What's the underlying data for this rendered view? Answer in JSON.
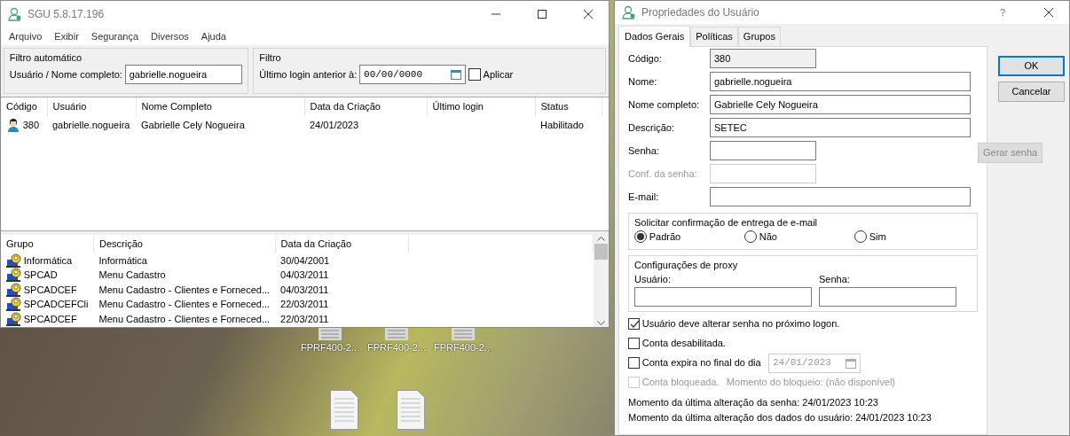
{
  "desktop": {
    "icons": [
      {
        "label": "FPRF400-2..."
      },
      {
        "label": "FPRF400-2..."
      },
      {
        "label": "FPRF400-2..."
      }
    ]
  },
  "main_window": {
    "title": "SGU 5.8.17.196",
    "menu": [
      "Arquivo",
      "Exibir",
      "Segurança",
      "Diversos",
      "Ajuda"
    ],
    "auto_filter": {
      "legend": "Filtro automático",
      "label": "Usuário / Nome completo:",
      "value": "gabrielle.nogueira"
    },
    "filter": {
      "legend": "Filtro",
      "label": "Último login anterior à:",
      "value": "00/00/0000",
      "apply_label": "Aplicar",
      "apply_checked": false
    },
    "users_table": {
      "columns": [
        "Código",
        "Usuário",
        "Nome Completo",
        "Data da Criação",
        "Último login",
        "Status"
      ],
      "rows": [
        {
          "code": "380",
          "user": "gabrielle.nogueira",
          "full_name": "Gabrielle Cely Nogueira",
          "created": "24/01/2023",
          "status": "Habilitado"
        }
      ]
    },
    "groups_table": {
      "columns": [
        "Grupo",
        "Descrição",
        "Data da Criação"
      ],
      "rows": [
        {
          "group": "Informática",
          "description": "Informática",
          "created": "30/04/2001"
        },
        {
          "group": "SPCAD",
          "description": "Menu Cadastro",
          "created": "04/03/2011"
        },
        {
          "group": "SPCADCEF",
          "description": "Menu Cadastro - Clientes e Forneced...",
          "created": "04/03/2011"
        },
        {
          "group": "SPCADCEFCli",
          "description": "Menu Cadastro - Clientes e Forneced...",
          "created": "22/03/2011"
        },
        {
          "group": "SPCADCEF",
          "description": "Menu Cadastro - Clientes e Forneced...",
          "created": "22/03/2011"
        }
      ]
    }
  },
  "dialog": {
    "title": "Propriedades do Usuário",
    "help": "?",
    "tabs": [
      {
        "label": "Dados Gerais",
        "selected": true
      },
      {
        "label": "Políticas",
        "selected": false
      },
      {
        "label": "Grupos",
        "selected": false
      }
    ],
    "fields": [
      {
        "kind": "readonly",
        "label": "Código:",
        "value": "380",
        "disabled": false
      },
      {
        "kind": "wide",
        "label": "Nome:",
        "value": "gabrielle.nogueira",
        "disabled": false
      },
      {
        "kind": "wide",
        "label": "Nome completo:",
        "value": "Gabrielle Cely Nogueira",
        "disabled": false
      },
      {
        "kind": "wide",
        "label": "Descrição:",
        "value": "SETEC",
        "disabled": false
      },
      {
        "kind": "short",
        "label": "Senha:",
        "disabled": false
      },
      {
        "kind": "short",
        "label": "Conf. da senha:",
        "disabled": true
      },
      {
        "kind": "wide",
        "label": "E-mail:",
        "disabled": false
      }
    ],
    "generate_button": {
      "label": "Gerar senha",
      "disabled": true
    },
    "email_confirmation": {
      "legend": "Solicitar confirmação de entrega de e-mail",
      "options": [
        {
          "label": "Padrão",
          "selected": true
        },
        {
          "label": "Não",
          "selected": false
        },
        {
          "label": "Sim",
          "selected": false
        }
      ]
    },
    "proxy": {
      "legend": "Configurações de proxy",
      "user_label": "Usuário:",
      "password_label": "Senha:"
    },
    "checkboxes": [
      {
        "kind": "plain",
        "label": "Usuário deve alterar senha no próximo logon.",
        "checked": true,
        "disabled": false
      },
      {
        "kind": "plain",
        "label": "Conta desabilitada.",
        "checked": false,
        "disabled": false
      },
      {
        "kind": "date",
        "label": "Conta expira no final do dia",
        "checked": false,
        "disabled": false,
        "date": "24/01/2023"
      },
      {
        "kind": "note",
        "label": "Conta bloqueada.",
        "checked": false,
        "disabled": true,
        "note": "Momento do bloqueio: (não disponível)"
      }
    ],
    "info": [
      "Momento da última alteração da senha: 24/01/2023 10:23",
      "Momento da última alteração dos dados do usuário: 24/01/2023 10:23"
    ],
    "buttons": [
      {
        "label": "OK",
        "default": true
      },
      {
        "label": "Cancelar",
        "default": false
      }
    ]
  }
}
